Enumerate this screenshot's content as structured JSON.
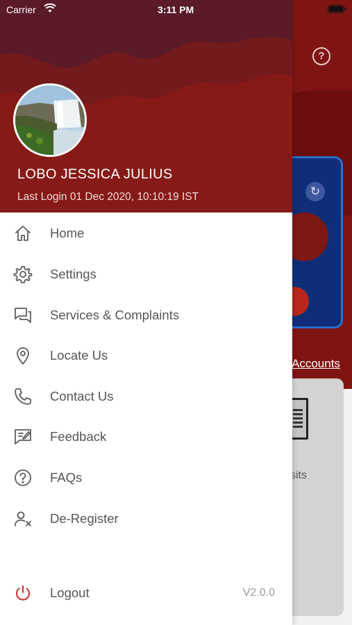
{
  "status_bar": {
    "carrier": "Carrier",
    "time": "3:11 PM"
  },
  "user": {
    "name": "LOBO JESSICA JULIUS",
    "last_login": "Last Login 01 Dec 2020, 10:10:19 IST"
  },
  "menu": {
    "items": [
      {
        "label": "Home",
        "icon": "home-icon"
      },
      {
        "label": "Settings",
        "icon": "gear-icon"
      },
      {
        "label": "Services & Complaints",
        "icon": "chat-icon"
      },
      {
        "label": "Locate Us",
        "icon": "location-pin-icon"
      },
      {
        "label": "Contact Us",
        "icon": "phone-icon"
      },
      {
        "label": "Feedback",
        "icon": "feedback-icon"
      },
      {
        "label": "FAQs",
        "icon": "question-circle-icon"
      },
      {
        "label": "De-Register",
        "icon": "remove-user-icon"
      }
    ],
    "logout_label": "Logout",
    "version": "V2.0.0"
  },
  "background": {
    "accounts_link": "Accounts",
    "tile_label": "sits"
  },
  "colors": {
    "header": "#861a16",
    "logout_icon": "#d12b26"
  }
}
